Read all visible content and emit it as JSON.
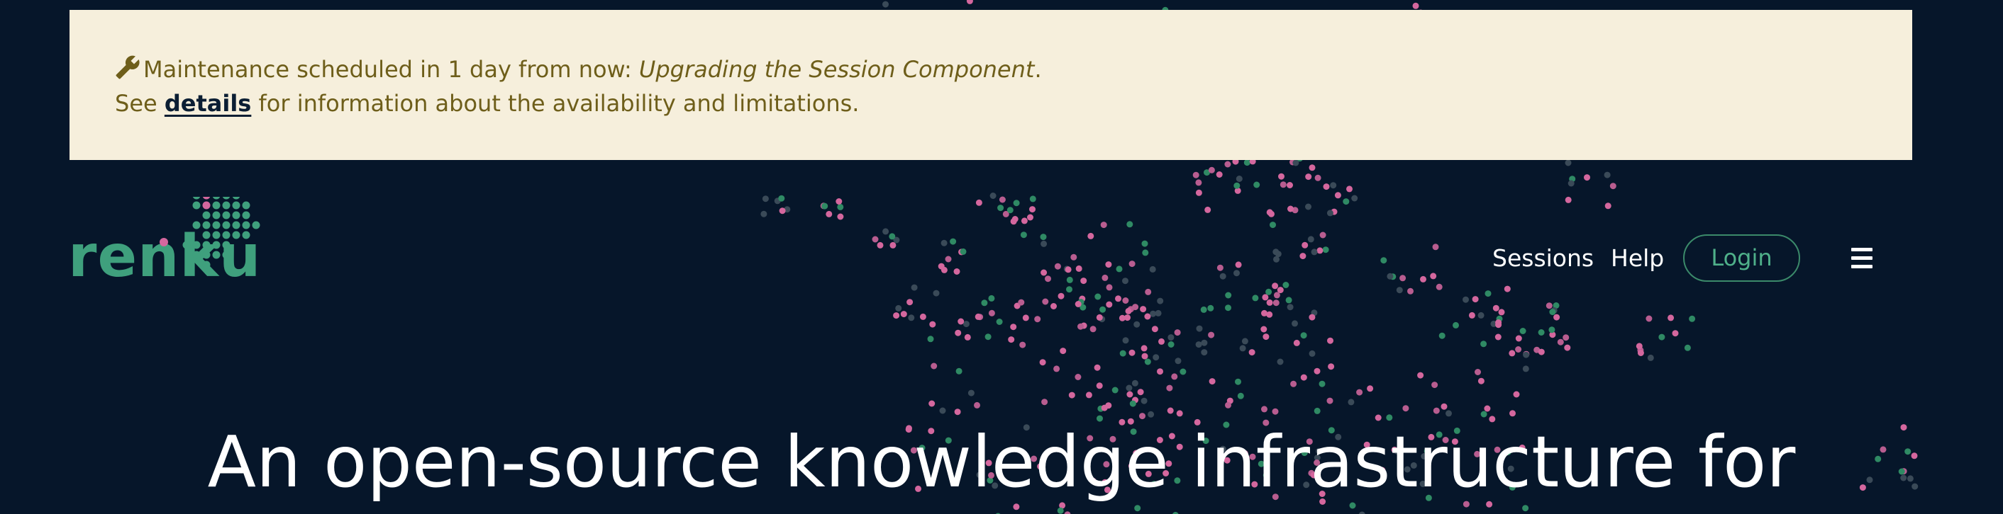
{
  "banner": {
    "icon": "wrench-icon",
    "prefix": "Maintenance scheduled in 1 day from now: ",
    "component": "Upgrading the Session Component",
    "suffix": ".",
    "see": "See ",
    "link": "details",
    "rest": " for information about the availability and limitations."
  },
  "brand": {
    "name": "renku",
    "logo_icon": "renku-logo-dots"
  },
  "nav": {
    "sessions": "Sessions",
    "help": "Help",
    "login": "Login",
    "menu_icon": "hamburger-icon"
  },
  "hero": {
    "headline": "An open-source knowledge infrastructure for"
  },
  "colors": {
    "background": "#06162a",
    "banner_bg": "#f6efdc",
    "banner_text": "#6e5e1a",
    "brand_green": "#3fa07d",
    "accent_pink": "#d4679e"
  }
}
